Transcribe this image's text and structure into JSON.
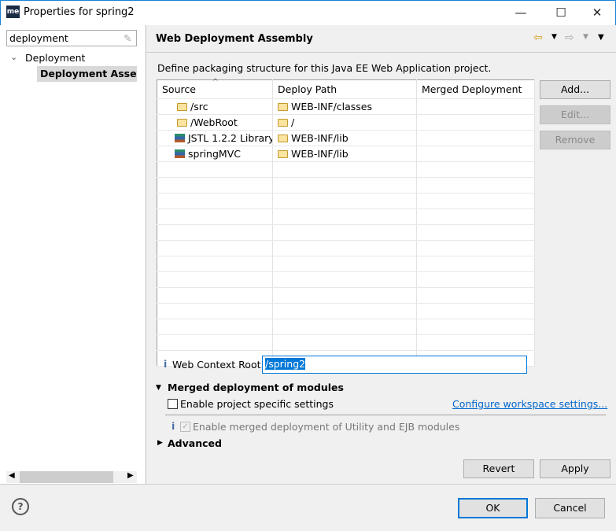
{
  "window": {
    "title": "Properties for spring2",
    "app_icon": "me"
  },
  "sidebar": {
    "filter_value": "deployment",
    "tree": [
      {
        "label": "Deployment",
        "expanded": true
      },
      {
        "label": "Deployment Assembly",
        "selected": true
      }
    ]
  },
  "page": {
    "title": "Web Deployment Assembly",
    "description": "Define packaging structure for this Java EE Web Application project."
  },
  "table": {
    "columns": [
      "Source",
      "Deploy Path",
      "Merged Deployment"
    ],
    "rows": [
      {
        "icon": "folder-icon",
        "source": "/src",
        "path": "WEB-INF/classes",
        "merged": ""
      },
      {
        "icon": "folder-icon",
        "source": "/WebRoot",
        "path": "/",
        "merged": ""
      },
      {
        "icon": "library-icon",
        "source": "JSTL 1.2.2 Library",
        "path": "WEB-INF/lib",
        "merged": ""
      },
      {
        "icon": "library-icon",
        "source": "springMVC",
        "path": "WEB-INF/lib",
        "merged": ""
      }
    ]
  },
  "buttons": {
    "add": "Add...",
    "edit": "Edit...",
    "remove": "Remove",
    "revert": "Revert",
    "apply": "Apply",
    "ok": "OK",
    "cancel": "Cancel"
  },
  "context_root": {
    "label": "Web Context Root:",
    "value": "/spring2"
  },
  "merged": {
    "title": "Merged deployment of modules",
    "enable_specific": "Enable project specific settings",
    "configure_link": "Configure workspace settings...",
    "enable_merged": "Enable merged deployment of Utility and EJB modules",
    "enable_merged_checked": true,
    "enable_specific_checked": false
  },
  "advanced": {
    "title": "Advanced"
  }
}
